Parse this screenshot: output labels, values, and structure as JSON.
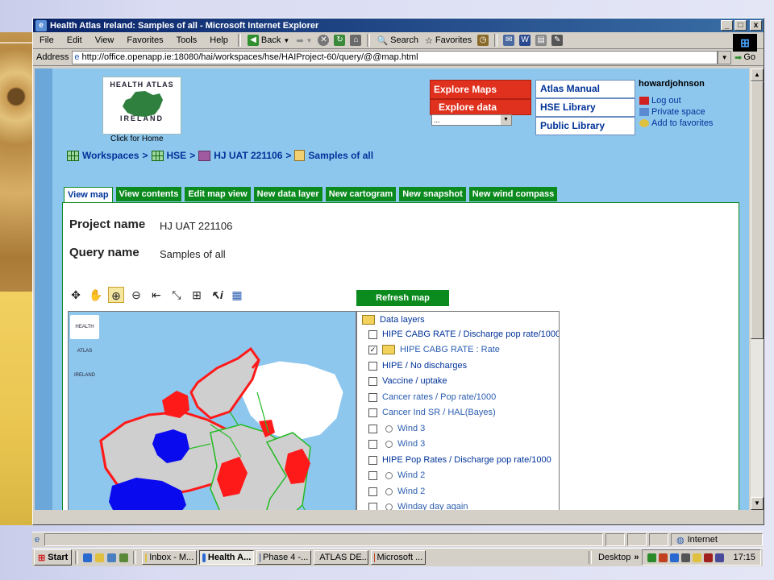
{
  "window": {
    "title": "Health Atlas Ireland: Samples of all - Microsoft Internet Explorer",
    "controls": {
      "minimize": "_",
      "maximize": "□",
      "close": "x"
    }
  },
  "menubar": {
    "items": [
      "File",
      "Edit",
      "View",
      "Favorites",
      "Tools",
      "Help"
    ],
    "back_label": "Back",
    "search_label": "Search",
    "favorites_label": "Favorites"
  },
  "addressbar": {
    "label": "Address",
    "url": "http://office.openapp.ie:18080/hai/workspaces/hse/HAIProject-60/query/@@map.html",
    "go_label": "Go"
  },
  "site": {
    "logo_top": "HEALTH ATLAS",
    "logo_bottom": "IRELAND",
    "click_home": "Click for Home",
    "nav_red": [
      "Explore Maps",
      "Explore data"
    ],
    "select_value": "...",
    "nav_white": [
      "Atlas Manual",
      "HSE Library",
      "Public Library"
    ],
    "username": "howardjohnson",
    "user_links": [
      "Log out",
      "Private space",
      "Add to favorites"
    ]
  },
  "breadcrumb": [
    "Workspaces",
    "HSE",
    "HJ UAT 221106",
    "Samples of all"
  ],
  "breadcrumb_sep": ">",
  "tabs": [
    "View map",
    "View contents",
    "Edit map view",
    "New data layer",
    "New cartogram",
    "New snapshot",
    "New wind compass"
  ],
  "project": {
    "project_label": "Project name",
    "project_value": "HJ UAT 221106",
    "query_label": "Query name",
    "query_value": "Samples of all"
  },
  "map_tools": [
    "pan",
    "hand",
    "zoom-in",
    "zoom-out",
    "previous-extent",
    "full-extent",
    "grid",
    "identify",
    "layers"
  ],
  "refresh_label": "Refresh map",
  "map_logo": "HEALTH ATLAS IRELAND",
  "layers": {
    "header": "Data layers",
    "items": [
      {
        "label": "HIPE CABG RATE / Discharge pop rate/1000",
        "checked": false,
        "kind": "layer"
      },
      {
        "label": "HIPE CABG RATE : Rate",
        "checked": true,
        "kind": "folder"
      },
      {
        "label": "HIPE / No discharges",
        "checked": false,
        "kind": "layer"
      },
      {
        "label": "Vaccine / uptake",
        "checked": false,
        "kind": "layer"
      },
      {
        "label": "Cancer rates / Pop rate/1000",
        "checked": false,
        "kind": "layer"
      },
      {
        "label": "Cancer Ind SR / HAL(Bayes)",
        "checked": false,
        "kind": "layer"
      },
      {
        "label": "Wind 3",
        "checked": false,
        "kind": "radio"
      },
      {
        "label": "Wind 3",
        "checked": false,
        "kind": "radio"
      },
      {
        "label": "HIPE Pop Rates / Discharge pop rate/1000",
        "checked": false,
        "kind": "layer"
      },
      {
        "label": "Wind 2",
        "checked": false,
        "kind": "radio"
      },
      {
        "label": "Wind 2",
        "checked": false,
        "kind": "radio"
      },
      {
        "label": "Winday day again",
        "checked": false,
        "kind": "radio"
      }
    ]
  },
  "statusbar": {
    "zone": "Internet"
  },
  "taskbar": {
    "start": "Start",
    "tasks": [
      "Inbox - M...",
      "Health A...",
      "Phase 4 -...",
      "ATLAS DE...",
      "Microsoft ..."
    ],
    "active_index": 1,
    "desktop_label": "Desktop",
    "clock": "17:15"
  },
  "colors": {
    "accent_green": "#0b8a1e",
    "nav_red": "#e0301e",
    "link_blue": "#003399",
    "page_bg": "#8ec7ee"
  }
}
